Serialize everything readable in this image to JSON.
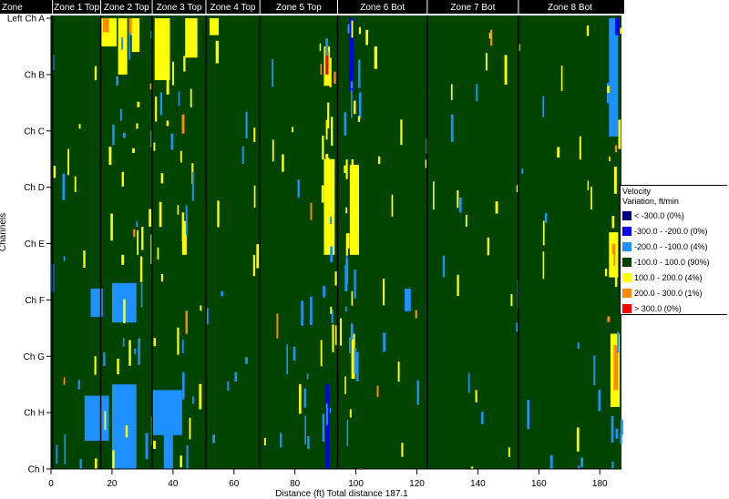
{
  "chart_data": {
    "type": "heatmap",
    "xlabel": "Distance (ft) Total distance 187.1",
    "ylabel": "Channels",
    "xlim": [
      0,
      187.1
    ],
    "x_ticks": [
      "0",
      "20",
      "40",
      "60",
      "80",
      "100",
      "120",
      "140",
      "160",
      "180"
    ],
    "channels": [
      "Left Ch A",
      "Ch B",
      "Ch C",
      "Ch D",
      "Ch E",
      "Ch F",
      "Ch G",
      "Ch H",
      "Ch I"
    ],
    "zones": [
      {
        "label": "Zone",
        "start": 0,
        "end": 0.5
      },
      {
        "label": "Zone 1 Top",
        "start": 0.5,
        "end": 16.3
      },
      {
        "label": "Zone 2 Top",
        "start": 16.3,
        "end": 33.2
      },
      {
        "label": "Zone 3 Top",
        "start": 33.2,
        "end": 50.8
      },
      {
        "label": "Zone 4 Top",
        "start": 50.8,
        "end": 68.5
      },
      {
        "label": "Zone 5 Top",
        "start": 68.5,
        "end": 94.0
      },
      {
        "label": "Zone 6 Bot",
        "start": 94.0,
        "end": 123.4
      },
      {
        "label": "Zone 7 Bot",
        "start": 123.4,
        "end": 153.3
      },
      {
        "label": "Zone 8 Bot",
        "start": 153.3,
        "end": 187.1
      }
    ],
    "legend": {
      "title_line1": "Velocity",
      "title_line2": "Variation, ft/min",
      "placement": "right",
      "items": [
        {
          "label": "< -300.0 (0%)",
          "color": "#000080"
        },
        {
          "label": "-300.0 - -200.0 (0%)",
          "color": "#0000ff"
        },
        {
          "label": "-200.0 - -100.0 (4%)",
          "color": "#1e90ff"
        },
        {
          "label": "-100.0 - 100.0 (90%)",
          "color": "#004400"
        },
        {
          "label": "100.0 - 200.0 (4%)",
          "color": "#ffff00"
        },
        {
          "label": "200.0 - 300.0 (1%)",
          "color": "#ff8c00"
        },
        {
          "label": "> 300.0 (0%)",
          "color": "#ff0000"
        }
      ]
    },
    "regions": [
      {
        "x": 16.5,
        "w": 5,
        "ch0": 0,
        "ch1": 0.5,
        "cls": 1
      },
      {
        "x": 17,
        "w": 2,
        "ch0": 0,
        "ch1": 0.25,
        "cls": 2
      },
      {
        "x": 22,
        "w": 3,
        "ch0": 0,
        "ch1": 1.0,
        "cls": 1
      },
      {
        "x": 25.5,
        "w": 2,
        "ch0": 0,
        "ch1": 0.3,
        "cls": 2
      },
      {
        "x": 26.5,
        "w": 2.5,
        "ch0": 0,
        "ch1": 0.6,
        "cls": 1
      },
      {
        "x": 34,
        "w": 5,
        "ch0": 0,
        "ch1": 1.1,
        "cls": 1
      },
      {
        "x": 44,
        "w": 4,
        "ch0": 0,
        "ch1": 0.7,
        "cls": 1
      },
      {
        "x": 52,
        "w": 3,
        "ch0": 0,
        "ch1": 0.3,
        "cls": 1
      },
      {
        "x": 54,
        "w": 1,
        "ch0": 0.4,
        "ch1": 0.8,
        "cls": 1
      },
      {
        "x": 89.5,
        "w": 2,
        "ch0": 0.5,
        "ch1": 1.2,
        "cls": 1
      },
      {
        "x": 90,
        "w": 1,
        "ch0": 0.6,
        "ch1": 1.0,
        "cls": 3
      },
      {
        "x": 89.5,
        "w": 3.5,
        "ch0": 2.5,
        "ch1": 4.2,
        "cls": 1
      },
      {
        "x": 98,
        "w": 3,
        "ch0": 2.6,
        "ch1": 4.2,
        "cls": 1
      },
      {
        "x": 97.8,
        "w": 1.5,
        "ch0": 0,
        "ch1": 1.3,
        "cls": -2
      },
      {
        "x": 106,
        "w": 1,
        "ch0": 0.5,
        "ch1": 0.9,
        "cls": 1
      },
      {
        "x": 183,
        "w": 3,
        "ch0": 0,
        "ch1": 2.1,
        "cls": -1
      },
      {
        "x": 185,
        "w": 1.5,
        "ch0": 0,
        "ch1": 0.3,
        "cls": -2
      },
      {
        "x": 183,
        "w": 3,
        "ch0": 3.8,
        "ch1": 4.6,
        "cls": 1
      },
      {
        "x": 184,
        "w": 1,
        "ch0": 4,
        "ch1": 4.4,
        "cls": 2
      },
      {
        "x": 183.5,
        "w": 3,
        "ch0": 5.6,
        "ch1": 6.9,
        "cls": 1
      },
      {
        "x": 184.5,
        "w": 1.5,
        "ch0": 5.8,
        "ch1": 6.6,
        "cls": 2
      },
      {
        "x": 13,
        "w": 4,
        "ch0": 4.8,
        "ch1": 5.3,
        "cls": -1
      },
      {
        "x": 20,
        "w": 8,
        "ch0": 4.7,
        "ch1": 5.4,
        "cls": -1
      },
      {
        "x": 11,
        "w": 8,
        "ch0": 6.7,
        "ch1": 7.5,
        "cls": -1
      },
      {
        "x": 20,
        "w": 8,
        "ch0": 6.5,
        "ch1": 8.0,
        "cls": -1
      },
      {
        "x": 33,
        "w": 10,
        "ch0": 6.6,
        "ch1": 7.4,
        "cls": -1
      },
      {
        "x": 37,
        "w": 3,
        "ch0": 7.4,
        "ch1": 8.0,
        "cls": -1
      },
      {
        "x": 90,
        "w": 1.2,
        "ch0": 6.5,
        "ch1": 8.0,
        "cls": -2
      },
      {
        "x": 43,
        "w": 1.5,
        "ch0": 3.6,
        "ch1": 4.2,
        "cls": 1
      },
      {
        "x": 98.5,
        "w": 1.2,
        "ch0": 5.6,
        "ch1": 6.4,
        "cls": 1
      },
      {
        "x": 116,
        "w": 2,
        "ch0": 4.8,
        "ch1": 5.2,
        "cls": -1
      }
    ]
  }
}
